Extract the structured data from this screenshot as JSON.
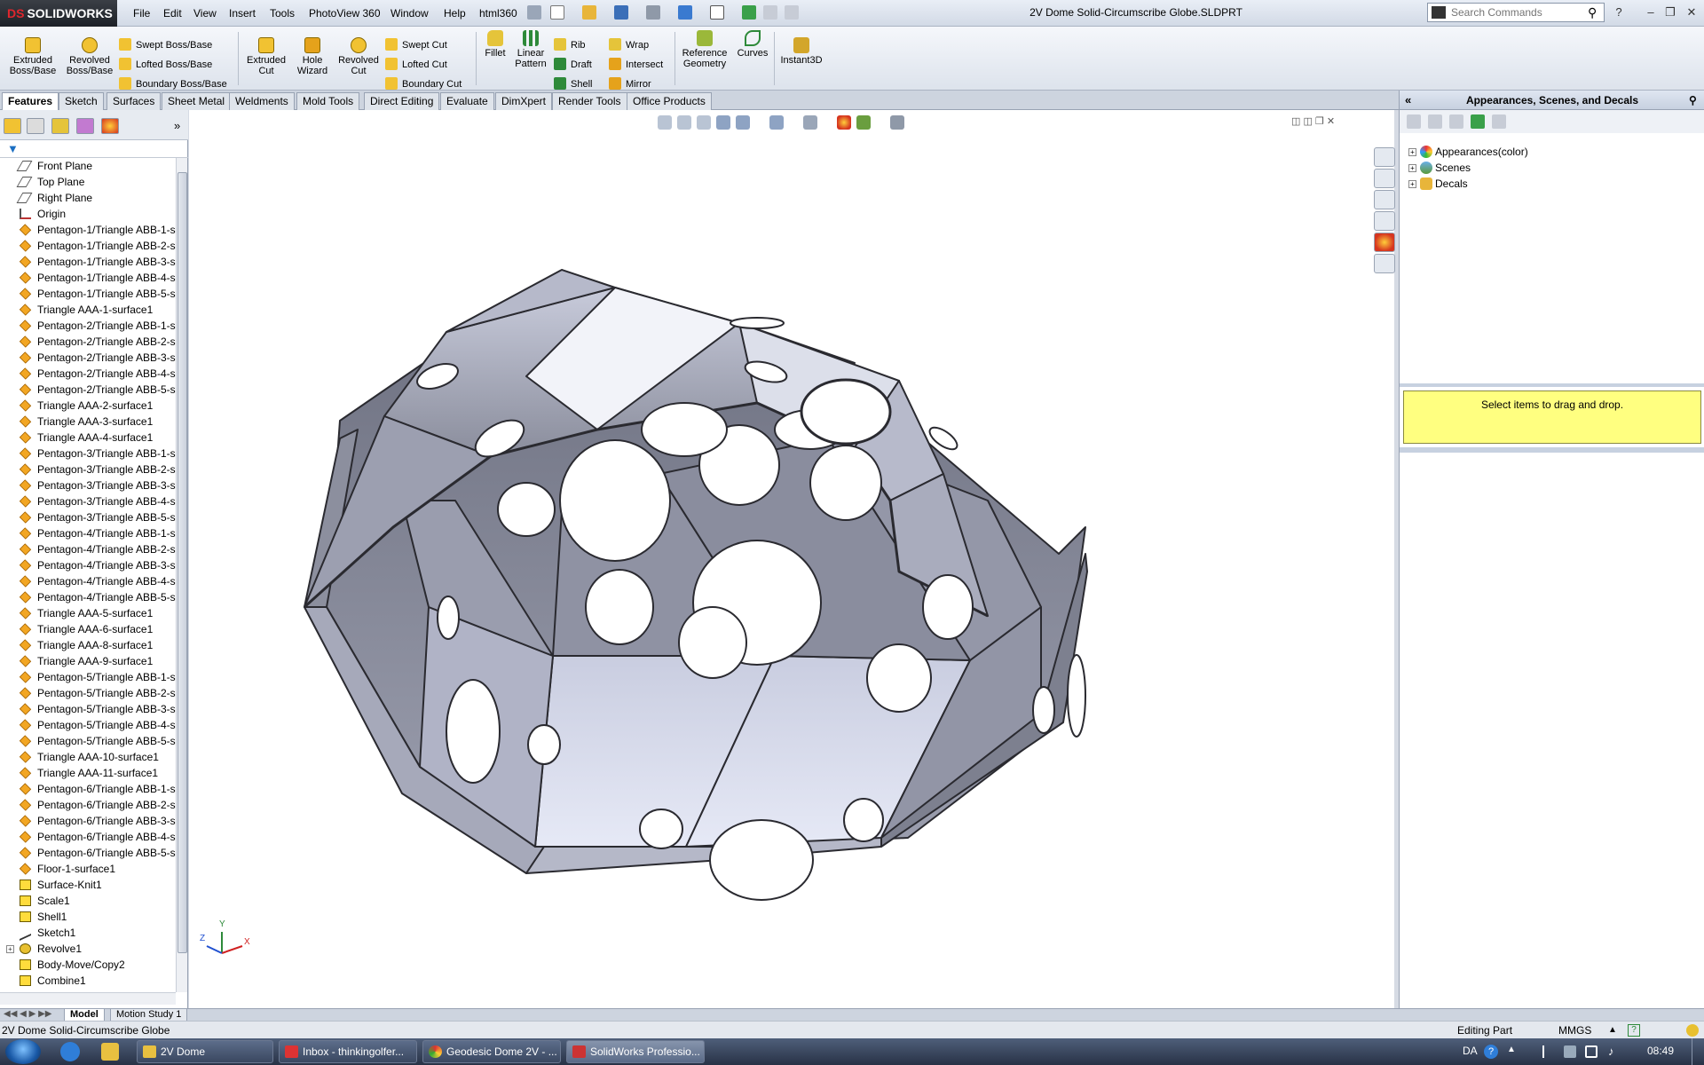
{
  "app": {
    "logo_text": "SOLIDWORKS",
    "doc_title": "2V Dome Solid-Circumscribe Globe.SLDPRT",
    "menus": [
      "File",
      "Edit",
      "View",
      "Insert",
      "Tools",
      "PhotoView 360",
      "Window",
      "Help",
      "html360"
    ],
    "search_placeholder": "Search Commands"
  },
  "commands": {
    "extruded_boss": "Extruded Boss/Base",
    "revolved_boss": "Revolved Boss/Base",
    "swept_boss": "Swept Boss/Base",
    "lofted_boss": "Lofted Boss/Base",
    "boundary_boss": "Boundary Boss/Base",
    "extruded_cut": "Extruded Cut",
    "hole_wizard": "Hole Wizard",
    "revolved_cut": "Revolved Cut",
    "swept_cut": "Swept Cut",
    "lofted_cut": "Lofted Cut",
    "boundary_cut": "Boundary Cut",
    "fillet": "Fillet",
    "linear_pattern": "Linear Pattern",
    "rib": "Rib",
    "draft": "Draft",
    "shell": "Shell",
    "wrap": "Wrap",
    "intersect": "Intersect",
    "mirror": "Mirror",
    "reference_geometry": "Reference Geometry",
    "curves": "Curves",
    "instant3d": "Instant3D"
  },
  "tabs": [
    "Features",
    "Sketch",
    "Surfaces",
    "Sheet Metal",
    "Weldments",
    "Mold Tools",
    "Direct Editing",
    "Evaluate",
    "DimXpert",
    "Render Tools",
    "Office Products"
  ],
  "feature_tree": [
    {
      "label": "Front Plane",
      "icon": "plane"
    },
    {
      "label": "Top Plane",
      "icon": "plane"
    },
    {
      "label": "Right Plane",
      "icon": "plane"
    },
    {
      "label": "Origin",
      "icon": "origin"
    },
    {
      "label": "Pentagon-1/Triangle ABB-1-s",
      "icon": "surf"
    },
    {
      "label": "Pentagon-1/Triangle ABB-2-s",
      "icon": "surf"
    },
    {
      "label": "Pentagon-1/Triangle ABB-3-s",
      "icon": "surf"
    },
    {
      "label": "Pentagon-1/Triangle ABB-4-s",
      "icon": "surf"
    },
    {
      "label": "Pentagon-1/Triangle ABB-5-s",
      "icon": "surf"
    },
    {
      "label": "Triangle AAA-1-surface1",
      "icon": "surf"
    },
    {
      "label": "Pentagon-2/Triangle ABB-1-s",
      "icon": "surf"
    },
    {
      "label": "Pentagon-2/Triangle ABB-2-s",
      "icon": "surf"
    },
    {
      "label": "Pentagon-2/Triangle ABB-3-s",
      "icon": "surf"
    },
    {
      "label": "Pentagon-2/Triangle ABB-4-s",
      "icon": "surf"
    },
    {
      "label": "Pentagon-2/Triangle ABB-5-s",
      "icon": "surf"
    },
    {
      "label": "Triangle AAA-2-surface1",
      "icon": "surf"
    },
    {
      "label": "Triangle AAA-3-surface1",
      "icon": "surf"
    },
    {
      "label": "Triangle AAA-4-surface1",
      "icon": "surf"
    },
    {
      "label": "Pentagon-3/Triangle ABB-1-s",
      "icon": "surf"
    },
    {
      "label": "Pentagon-3/Triangle ABB-2-s",
      "icon": "surf"
    },
    {
      "label": "Pentagon-3/Triangle ABB-3-s",
      "icon": "surf"
    },
    {
      "label": "Pentagon-3/Triangle ABB-4-s",
      "icon": "surf"
    },
    {
      "label": "Pentagon-3/Triangle ABB-5-s",
      "icon": "surf"
    },
    {
      "label": "Pentagon-4/Triangle ABB-1-s",
      "icon": "surf"
    },
    {
      "label": "Pentagon-4/Triangle ABB-2-s",
      "icon": "surf"
    },
    {
      "label": "Pentagon-4/Triangle ABB-3-s",
      "icon": "surf"
    },
    {
      "label": "Pentagon-4/Triangle ABB-4-s",
      "icon": "surf"
    },
    {
      "label": "Pentagon-4/Triangle ABB-5-s",
      "icon": "surf"
    },
    {
      "label": "Triangle AAA-5-surface1",
      "icon": "surf"
    },
    {
      "label": "Triangle AAA-6-surface1",
      "icon": "surf"
    },
    {
      "label": "Triangle AAA-8-surface1",
      "icon": "surf"
    },
    {
      "label": "Triangle AAA-9-surface1",
      "icon": "surf"
    },
    {
      "label": "Pentagon-5/Triangle ABB-1-s",
      "icon": "surf"
    },
    {
      "label": "Pentagon-5/Triangle ABB-2-s",
      "icon": "surf"
    },
    {
      "label": "Pentagon-5/Triangle ABB-3-s",
      "icon": "surf"
    },
    {
      "label": "Pentagon-5/Triangle ABB-4-s",
      "icon": "surf"
    },
    {
      "label": "Pentagon-5/Triangle ABB-5-s",
      "icon": "surf"
    },
    {
      "label": "Triangle AAA-10-surface1",
      "icon": "surf"
    },
    {
      "label": "Triangle AAA-11-surface1",
      "icon": "surf"
    },
    {
      "label": "Pentagon-6/Triangle ABB-1-s",
      "icon": "surf"
    },
    {
      "label": "Pentagon-6/Triangle ABB-2-s",
      "icon": "surf"
    },
    {
      "label": "Pentagon-6/Triangle ABB-3-s",
      "icon": "surf"
    },
    {
      "label": "Pentagon-6/Triangle ABB-4-s",
      "icon": "surf"
    },
    {
      "label": "Pentagon-6/Triangle ABB-5-s",
      "icon": "surf"
    },
    {
      "label": "Floor-1-surface1",
      "icon": "surf"
    },
    {
      "label": "Surface-Knit1",
      "icon": "body"
    },
    {
      "label": "Scale1",
      "icon": "body"
    },
    {
      "label": "Shell1",
      "icon": "body"
    },
    {
      "label": "Sketch1",
      "icon": "sketch"
    },
    {
      "label": "Revolve1",
      "icon": "revolve",
      "expandable": true
    },
    {
      "label": "Body-Move/Copy2",
      "icon": "body"
    },
    {
      "label": "Combine1",
      "icon": "body"
    }
  ],
  "task_pane": {
    "title": "Appearances, Scenes, and Decals",
    "nodes": [
      "Appearances(color)",
      "Scenes",
      "Decals"
    ],
    "drag_hint": "Select items to drag and drop."
  },
  "bottom_tabs": [
    "Model",
    "Motion Study 1"
  ],
  "status": {
    "left": "2V Dome Solid-Circumscribe Globe",
    "mode": "Editing Part",
    "units": "MMGS"
  },
  "taskbar": {
    "items": [
      "2V Dome",
      "Inbox - thinkingolfer...",
      "Geodesic Dome 2V - ...",
      "SolidWorks Professio..."
    ],
    "lang": "DA",
    "clock": "08:49"
  },
  "triad": {
    "x": "X",
    "y": "Y",
    "z": "Z"
  },
  "colors": {
    "accent": "#f2a623",
    "highlight": "#ffff80",
    "logo_red": "#e0262d"
  }
}
